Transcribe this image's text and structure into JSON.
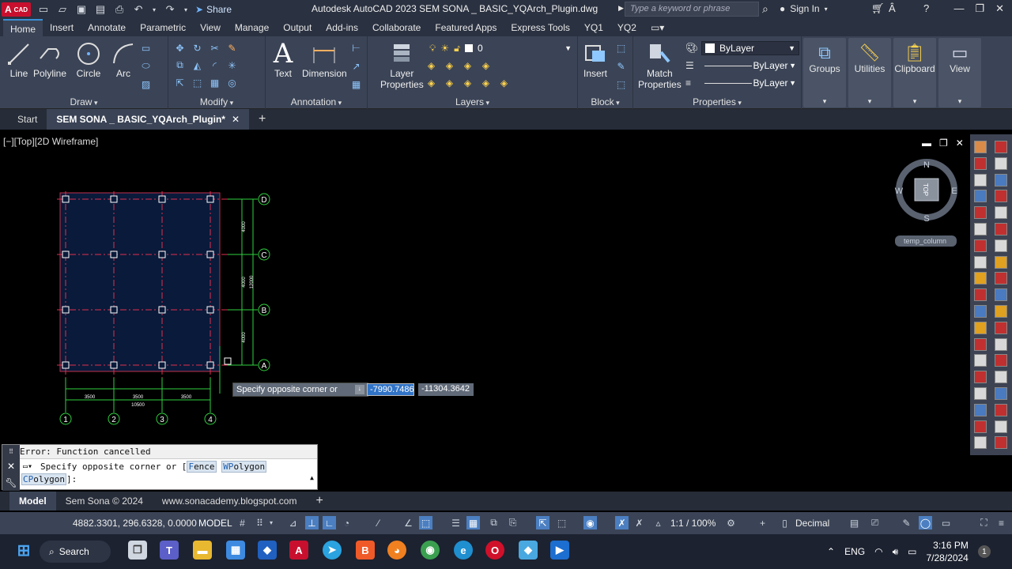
{
  "titlebar": {
    "app_logo": "A",
    "app_logo_sub": "CAD",
    "share_label": "Share",
    "title": "Autodesk AutoCAD 2023    SEM SONA _ BASIC_YQArch_Plugin.dwg",
    "search_placeholder": "Type a keyword or phrase",
    "sign_in": "Sign In"
  },
  "ribbon_tabs": [
    "Home",
    "Insert",
    "Annotate",
    "Parametric",
    "View",
    "Manage",
    "Output",
    "Add-ins",
    "Collaborate",
    "Featured Apps",
    "Express Tools",
    "YQ1",
    "YQ2"
  ],
  "ribbon": {
    "draw": {
      "title": "Draw",
      "line": "Line",
      "polyline": "Polyline",
      "circle": "Circle",
      "arc": "Arc"
    },
    "modify": {
      "title": "Modify"
    },
    "annotation": {
      "title": "Annotation",
      "text": "Text",
      "dimension": "Dimension"
    },
    "layers": {
      "title": "Layers",
      "layer_properties_1": "Layer",
      "layer_properties_2": "Properties",
      "current_layer": "0"
    },
    "block": {
      "title": "Block",
      "insert": "Insert"
    },
    "properties": {
      "title": "Properties",
      "match_1": "Match",
      "match_2": "Properties",
      "color": "ByLayer",
      "linetype": "ByLayer",
      "lineweight": "ByLayer"
    },
    "groups": "Groups",
    "utilities": "Utilities",
    "clipboard": "Clipboard",
    "view": "View"
  },
  "file_tabs": {
    "start": "Start",
    "active": "SEM SONA _ BASIC_YQArch_Plugin*"
  },
  "viewport": {
    "label": "[−][Top][2D Wireframe]",
    "viewcube": {
      "n": "N",
      "s": "S",
      "e": "E",
      "w": "W",
      "face": "TOP"
    },
    "ucs_name": "temp_column"
  },
  "drawing": {
    "grid_rows": [
      "D",
      "C",
      "B",
      "A"
    ],
    "grid_cols": [
      "1",
      "2",
      "3",
      "4"
    ],
    "dim_vertical": [
      "4000",
      "4000",
      "4000"
    ],
    "dim_vertical_total": "12000",
    "dim_horizontal": [
      "3500",
      "3500",
      "3500"
    ],
    "dim_horizontal_total": "10500"
  },
  "dynamic_input": {
    "prompt": "Specify opposite corner or",
    "x_value": "-7990.7486",
    "y_value": "-11304.3642"
  },
  "command": {
    "history": "Error: Function cancelled",
    "line_1a": "Specify opposite corner or [",
    "opt_fence_k": "F",
    "opt_fence_r": "ence",
    "opt_wpoly_k": "WP",
    "opt_wpoly_r": "olygon",
    "opt_cpoly_k": "CP",
    "opt_cpoly_r": "olygon",
    "line_end": "]:"
  },
  "layout_tabs": [
    "Model",
    "Sem Sona © 2024",
    "www.sonacademy.blogspot.com"
  ],
  "status": {
    "coords": "4882.3301, 296.6328, 0.0000",
    "space": "MODEL",
    "scale": "1:1 / 100%",
    "units": "Decimal"
  },
  "taskbar": {
    "search": "Search",
    "lang": "ENG",
    "time": "3:16 PM",
    "date": "7/28/2024",
    "badge": "1"
  }
}
